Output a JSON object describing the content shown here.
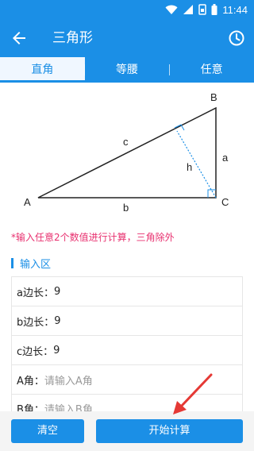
{
  "statusbar": {
    "time": "11:44",
    "icons": [
      "wifi-icon",
      "signal-icon",
      "sim-card-icon",
      "battery-icon"
    ]
  },
  "appbar": {
    "title": "三角形",
    "back_icon": "arrow-left-icon",
    "history_icon": "history-clock-icon"
  },
  "tabs": [
    {
      "label": "直角",
      "active": true
    },
    {
      "label": "等腰",
      "active": false
    },
    {
      "label": "任意",
      "active": false
    }
  ],
  "diagram": {
    "labels": {
      "A": "A",
      "B": "B",
      "C": "C",
      "a": "a",
      "b": "b",
      "c": "c",
      "h": "h"
    }
  },
  "hint": "*输入任意2个数值进行计算，三角除外",
  "section": {
    "title": "输入区"
  },
  "inputs": [
    {
      "label": "a边长：",
      "value": "9",
      "placeholder": ""
    },
    {
      "label": "b边长：",
      "value": "9",
      "placeholder": ""
    },
    {
      "label": "c边长：",
      "value": "9",
      "placeholder": ""
    },
    {
      "label": "A角：",
      "value": "",
      "placeholder": "请输入A角"
    },
    {
      "label": "B角：",
      "value": "",
      "placeholder": "请输入B角"
    }
  ],
  "buttons": {
    "clear": "清空",
    "calculate": "开始计算"
  },
  "colors": {
    "primary": "#1b8fe6",
    "hint": "#e8306f",
    "arrow": "#e53935"
  }
}
